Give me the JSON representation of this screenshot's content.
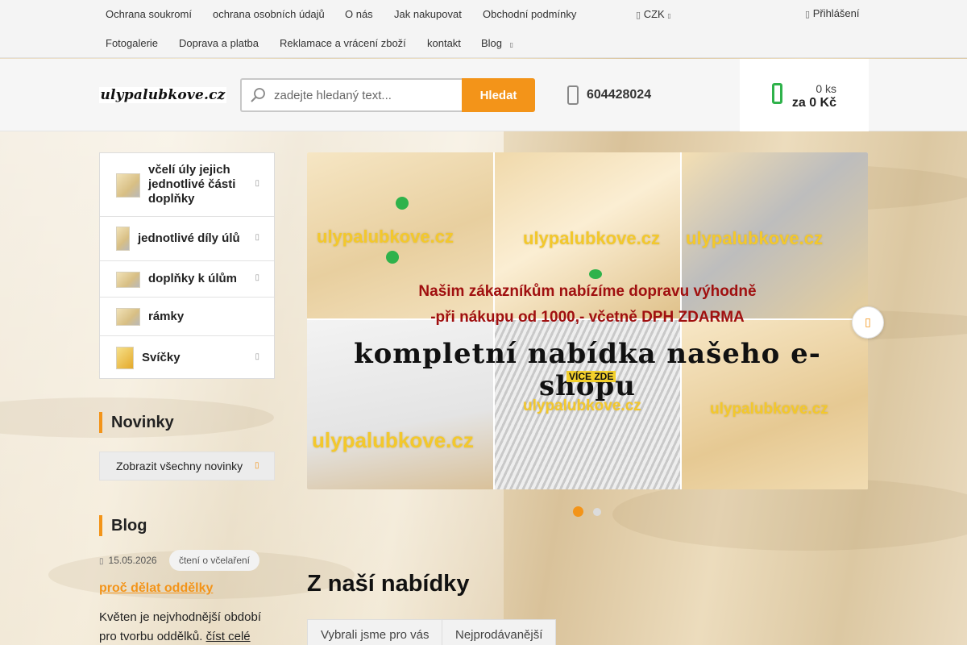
{
  "top_nav": {
    "row1": [
      "Ochrana soukromí",
      "ochrana osobních údajů",
      "O nás",
      "Jak nakupovat",
      "Obchodní podmínky"
    ],
    "row2": [
      "Fotogalerie",
      "Doprava a platba",
      "Reklamace a vrácení zboží",
      "kontakt",
      "Blog"
    ],
    "currency": "CZK",
    "login": "Přihlášení"
  },
  "header": {
    "logo_text": "ulypalubkove.cz",
    "search_placeholder": "zadejte hledaný text...",
    "search_button": "Hledat",
    "phone": "604428024",
    "cart_qty": "0 ks",
    "cart_total": "za 0 Kč"
  },
  "categories": [
    {
      "label": "včelí úly jejich jednotlivé části doplňky"
    },
    {
      "label": "jednotlivé díly úlů"
    },
    {
      "label": "doplňky k úlům"
    },
    {
      "label": "rámky"
    },
    {
      "label": "Svíčky"
    }
  ],
  "news": {
    "title": "Novinky",
    "show_all": "Zobrazit všechny novinky"
  },
  "blog": {
    "title": "Blog",
    "date": "15.05.2026",
    "tag": "čtení o včelaření",
    "post_title": "proč dělat oddělky",
    "excerpt": "Květen je nejvhodnější období pro tvorbu oddělků.",
    "read_more": "číst celé"
  },
  "slider": {
    "watermark": "ulypalubkove.cz",
    "promo_line1": "Našim zákazníkům nabízíme dopravu výhodně",
    "promo_line2": "-při nákupu od 1000,- včetně DPH  ZDARMA",
    "headline": "kompletní  nabídka  našeho  e-shopu",
    "more": "VÍCE ZDE",
    "active_slide": 1,
    "slide_count": 2
  },
  "offer": {
    "title": "Z naší nabídky",
    "tabs": [
      "Vybrali jsme pro vás",
      "Nejprodávanější"
    ]
  },
  "colors": {
    "accent": "#f39419",
    "cart_green": "#2fb24b",
    "promo_red": "#a01010"
  },
  "icons": {
    "lang": "globe-icon",
    "login": "user-icon",
    "search": "magnifier-icon",
    "phone": "phone-icon",
    "cart": "cart-icon",
    "calendar": "calendar-icon"
  }
}
